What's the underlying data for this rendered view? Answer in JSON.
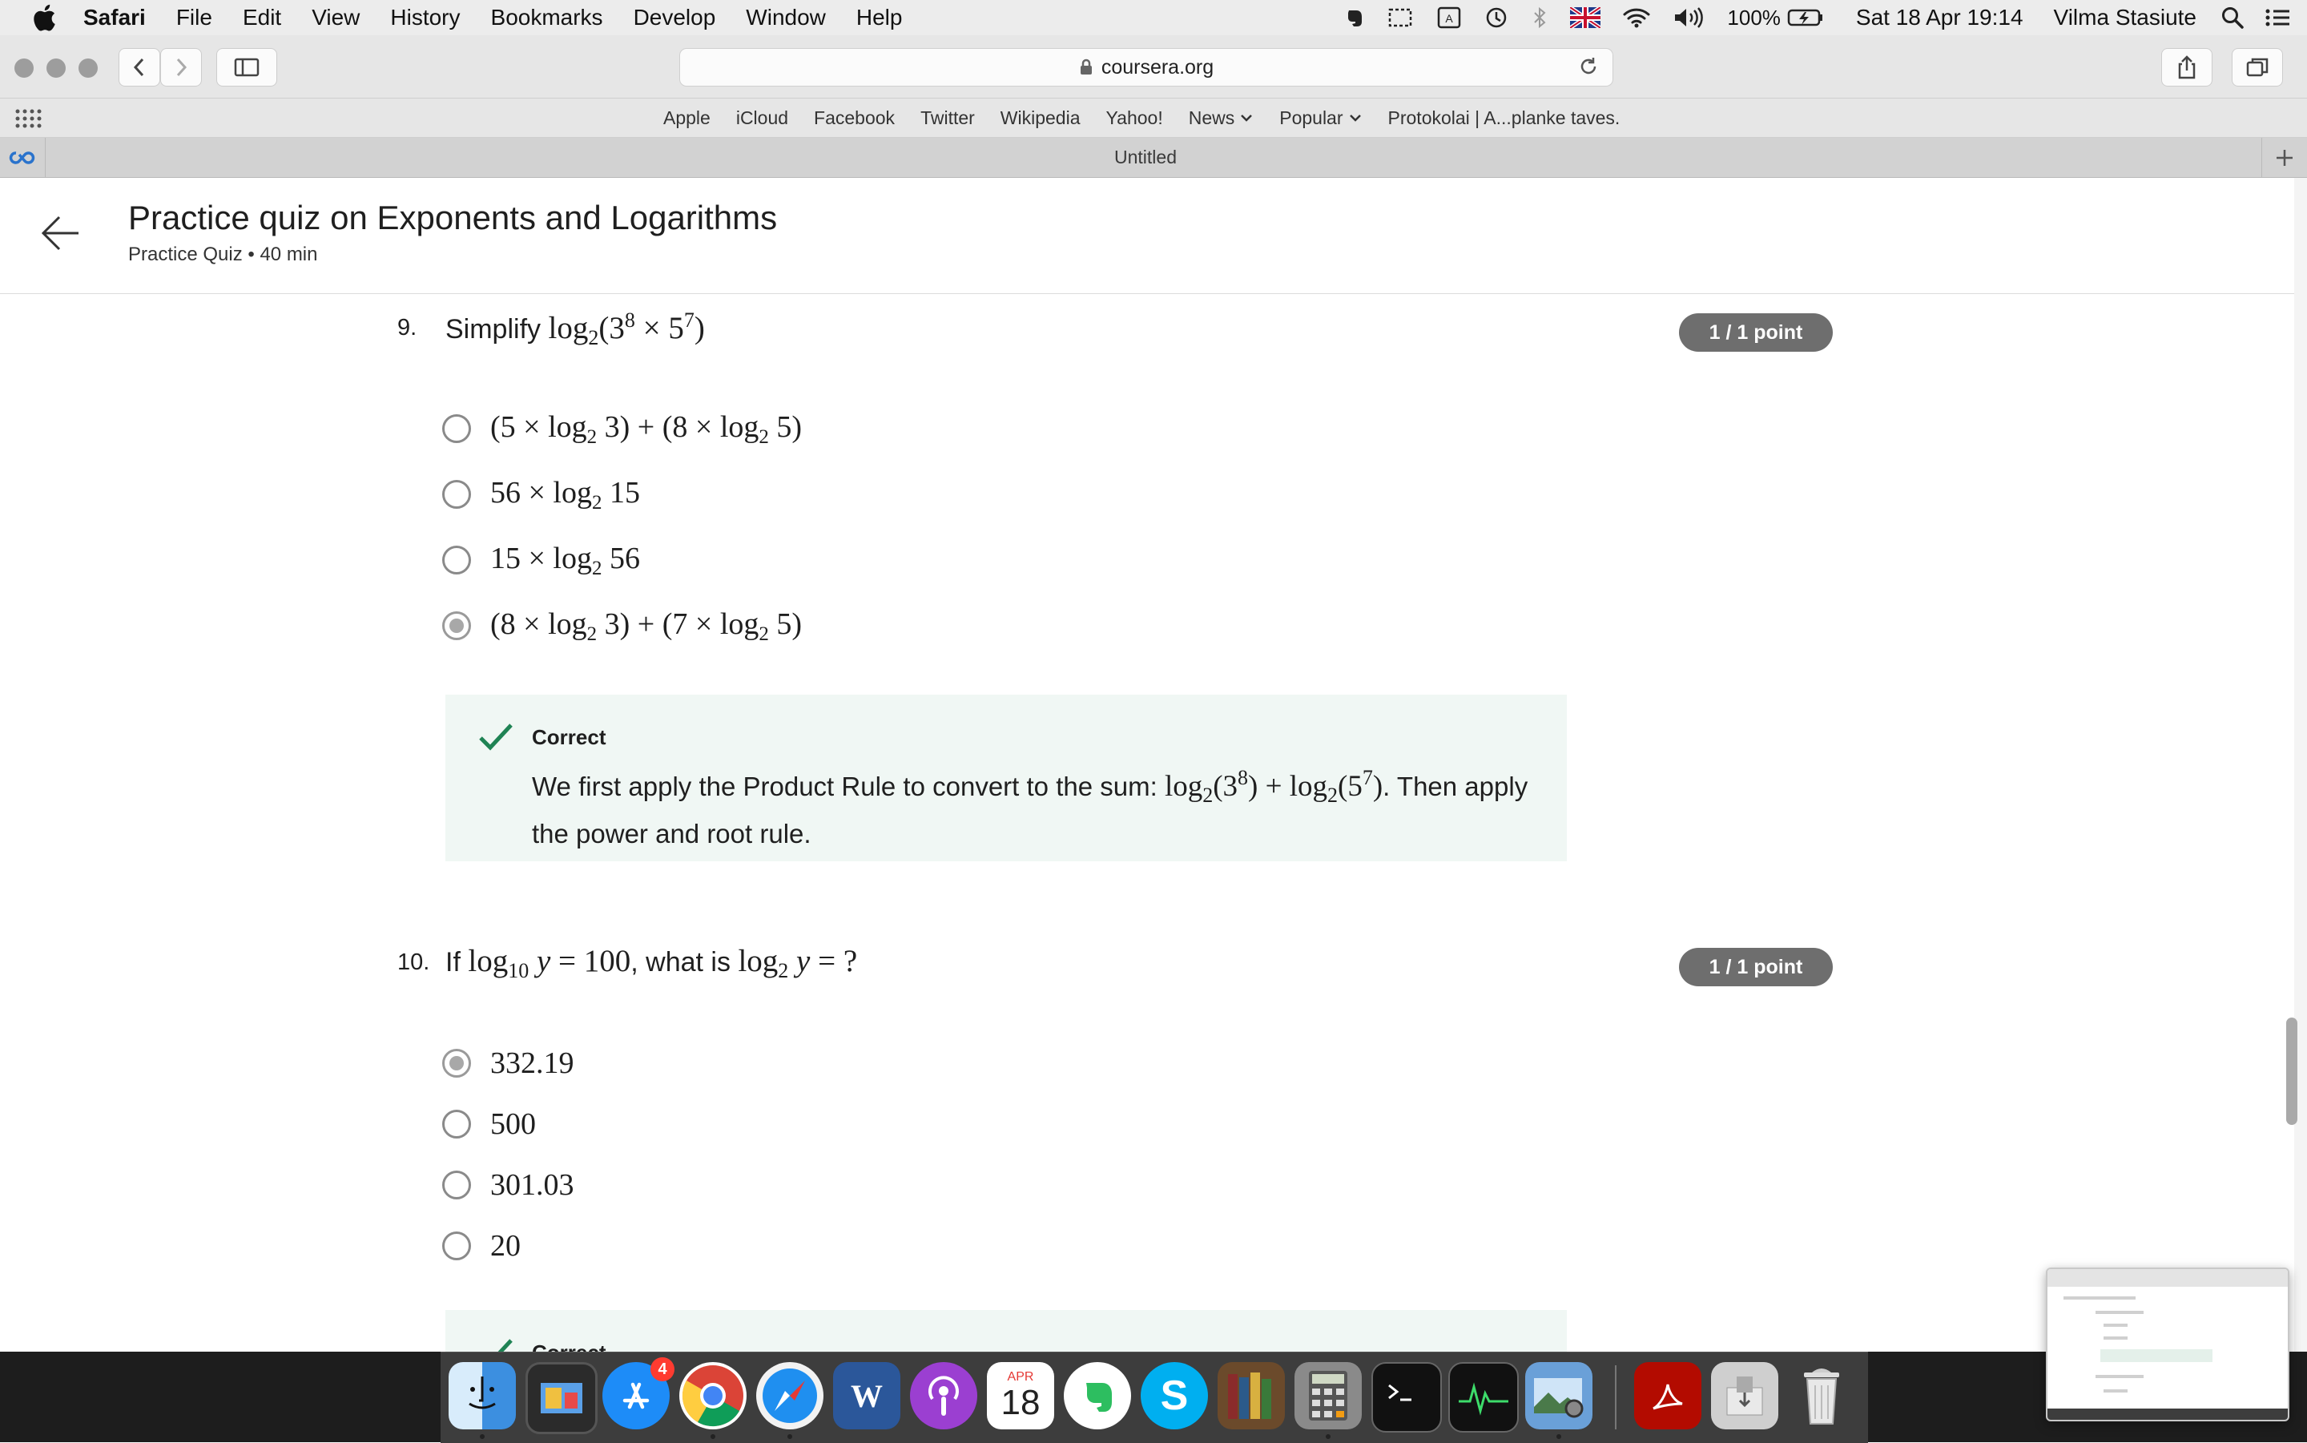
{
  "menubar": {
    "app_name": "Safari",
    "items": [
      "File",
      "Edit",
      "View",
      "History",
      "Bookmarks",
      "Develop",
      "Window",
      "Help"
    ],
    "battery": "100%",
    "clock": "Sat 18 Apr  19:14",
    "user": "Vilma Stasiute"
  },
  "browser": {
    "url": "coursera.org",
    "favorites": [
      "Apple",
      "iCloud",
      "Facebook",
      "Twitter",
      "Wikipedia",
      "Yahoo!",
      "News",
      "Popular",
      "Protokolai | A...planke taves."
    ],
    "tab_title": "Untitled"
  },
  "page": {
    "title": "Practice quiz on Exponents and Logarithms",
    "subtitle": "Practice Quiz • 40 min"
  },
  "questions": [
    {
      "number": "9.",
      "prompt_prefix": "Simplify",
      "points": "1 / 1 point",
      "options": [
        {
          "text": "(5 × log₂ 3) + (8 × log₂ 5)",
          "selected": false
        },
        {
          "text": "56 × log₂ 15",
          "selected": false
        },
        {
          "text": "15 × log₂ 56",
          "selected": false
        },
        {
          "text": "(8 × log₂ 3) + (7 × log₂ 5)",
          "selected": true
        }
      ],
      "feedback": {
        "title": "Correct",
        "text_before": "We first apply the Product Rule to convert to the sum:",
        "text_after": ". Then apply the power and root rule."
      }
    },
    {
      "number": "10.",
      "prompt_prefix": "If",
      "prompt_middle": ", what is",
      "points": "1 / 1 point",
      "options": [
        {
          "text": "332.19",
          "selected": true
        },
        {
          "text": "500",
          "selected": false
        },
        {
          "text": "301.03",
          "selected": false
        },
        {
          "text": "20",
          "selected": false
        }
      ],
      "feedback": {
        "title": "Correct"
      }
    }
  ],
  "dock": {
    "app_store_badge": "4",
    "calendar_month": "APR",
    "calendar_day": "18"
  }
}
